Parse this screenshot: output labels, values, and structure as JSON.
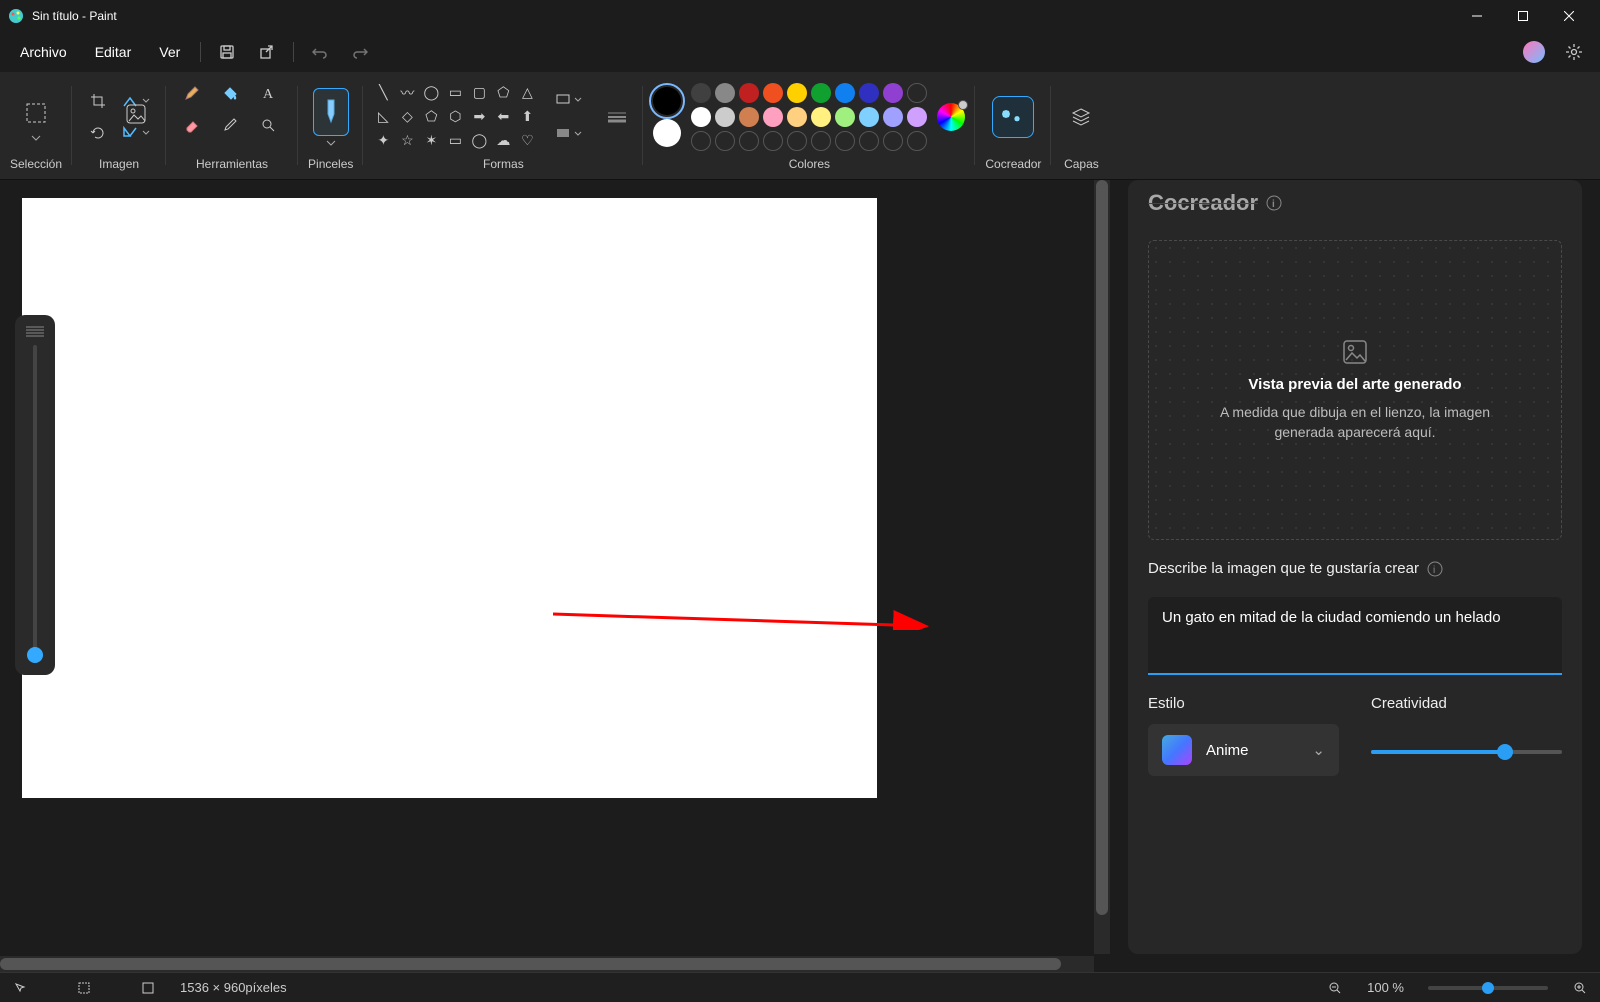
{
  "window": {
    "title": "Sin título - Paint"
  },
  "menu": {
    "file": "Archivo",
    "edit": "Editar",
    "view": "Ver"
  },
  "ribbon": {
    "selection": "Selección",
    "image": "Imagen",
    "tools": "Herramientas",
    "brushes": "Pinceles",
    "shapes": "Formas",
    "colors": "Colores",
    "cocreator": "Cocreador",
    "layers": "Capas"
  },
  "palette_row1": [
    "#404040",
    "#888888",
    "#c02020",
    "#f05020",
    "#ffd000",
    "#10a030",
    "#1080f0",
    "#3030c0",
    "#9040d0"
  ],
  "palette_row2": [
    "#ffffff",
    "#cccccc",
    "#d08050",
    "#ffa0c0",
    "#ffd080",
    "#fff080",
    "#a0f080",
    "#80d0ff",
    "#a0a0ff",
    "#d0a0ff"
  ],
  "cocreator": {
    "title": "Cocreador",
    "preview_title": "Vista previa del arte generado",
    "preview_sub": "A medida que dibuja en el lienzo, la imagen generada aparecerá aquí.",
    "describe_label": "Describe la imagen que te gustaría crear",
    "prompt_value": "Un gato en mitad de la ciudad comiendo un helado",
    "style_label": "Estilo",
    "style_value": "Anime",
    "creativity_label": "Creatividad",
    "creativity_value": 70
  },
  "status": {
    "dimensions": "1536 × 960píxeles",
    "zoom": "100 %"
  }
}
